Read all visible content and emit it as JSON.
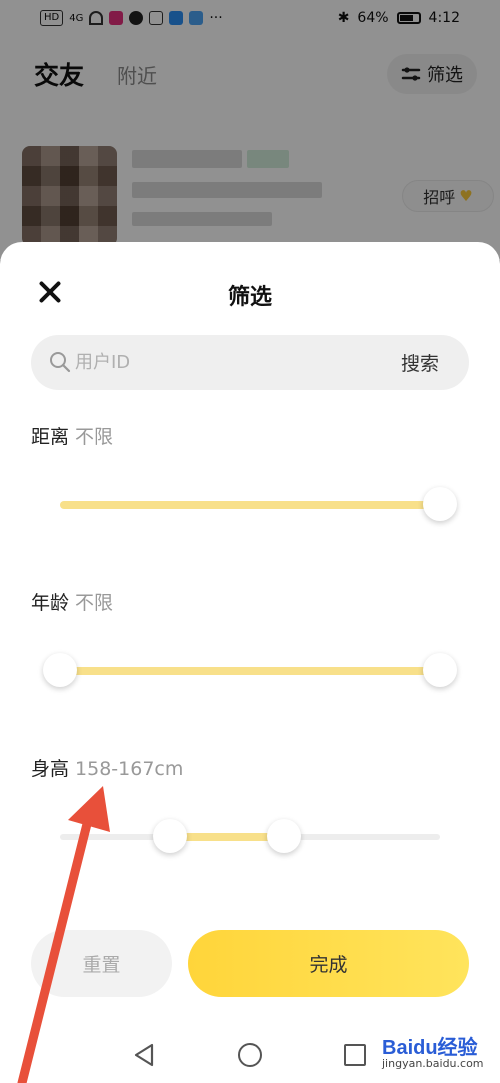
{
  "status_bar": {
    "network": "HD",
    "signal_label": "4G",
    "battery": "64%",
    "time": "4:12",
    "more": "···"
  },
  "background": {
    "tab_friends": "交友",
    "tab_nearby": "附近",
    "filter_label": "筛选",
    "greet_label": "招呼"
  },
  "sheet": {
    "title": "筛选",
    "search": {
      "placeholder": "用户ID",
      "button": "搜索"
    },
    "sections": [
      {
        "label": "距离",
        "value": "不限",
        "range": [
          1.0,
          1.0
        ]
      },
      {
        "label": "年龄",
        "value": "不限",
        "range": [
          0.0,
          1.0
        ]
      },
      {
        "label": "身高",
        "value": "158-167cm",
        "range": [
          0.29,
          0.59
        ]
      }
    ],
    "reset_label": "重置",
    "done_label": "完成"
  },
  "colors": {
    "accent": "#ffd53a",
    "track_fill": "#f8e08a",
    "arrow": "#e8503a"
  },
  "watermark": {
    "brand": "Baidu经验",
    "url": "jingyan.baidu.com"
  }
}
